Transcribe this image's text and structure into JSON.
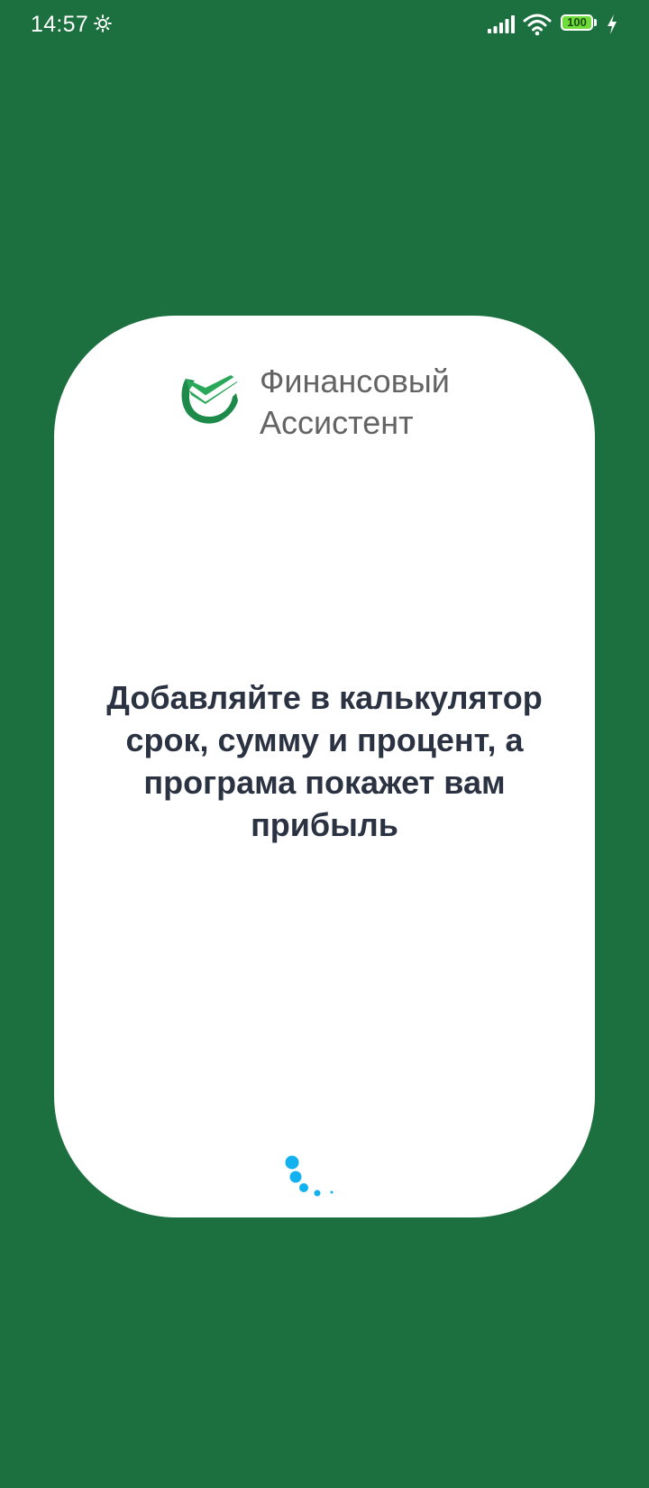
{
  "status_bar": {
    "time": "14:57",
    "battery_level": "100",
    "icons": [
      "gear-icon",
      "signal-icon",
      "wifi-icon",
      "battery-icon",
      "charging-icon"
    ]
  },
  "splash": {
    "logo_title": "Финансовый Ассистент",
    "message": "Добавляйте в калькулятор срок, сумму и процент, а програма покажет вам прибыль",
    "loader_icon": "loading-spinner-icon"
  },
  "colors": {
    "background": "#1c703f",
    "card": "#ffffff",
    "logo_text": "#646464",
    "message_text": "#2b3342",
    "loader": "#12b2f0",
    "battery_fill": "#6fdc3c"
  }
}
